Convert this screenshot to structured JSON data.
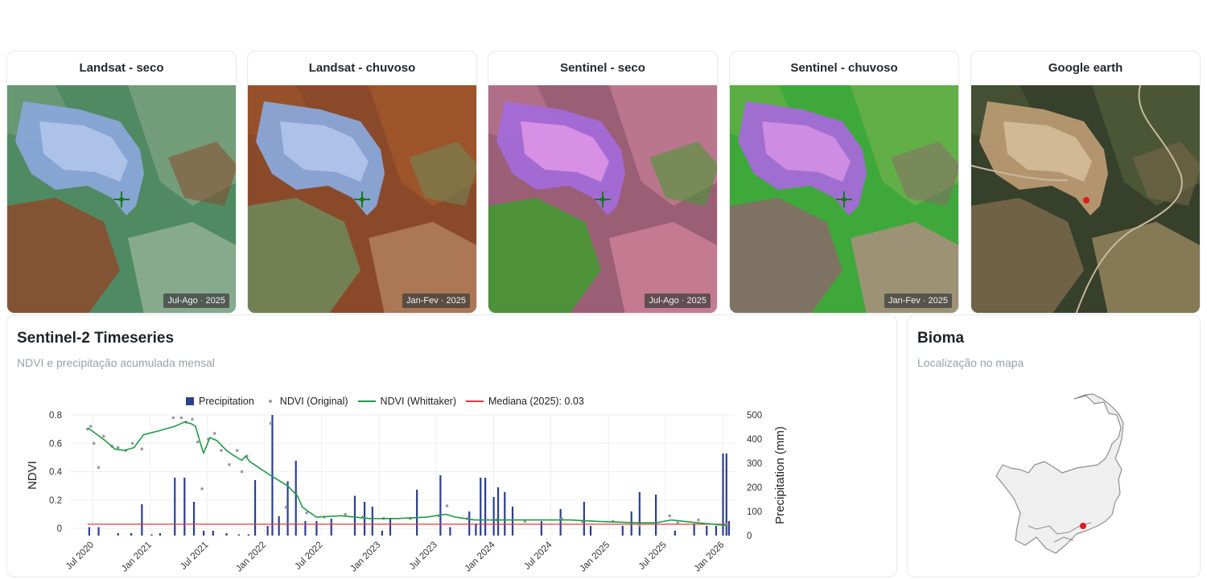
{
  "tiles": [
    {
      "title": "Landsat - seco",
      "date": "Jul-Ago · 2025",
      "palette": "landsat_dry"
    },
    {
      "title": "Landsat - chuvoso",
      "date": "Jan-Fev · 2025",
      "palette": "landsat_wet"
    },
    {
      "title": "Sentinel - seco",
      "date": "Jul-Ago · 2025",
      "palette": "sentinel_dry"
    },
    {
      "title": "Sentinel - chuvoso",
      "date": "Jan-Fev · 2025",
      "palette": "sentinel_wet"
    },
    {
      "title": "Google earth",
      "date": "",
      "palette": "google"
    }
  ],
  "palettes": {
    "landsat_dry": {
      "bg": "#4f8a63",
      "a": "#7aa07e",
      "b": "#8b4a2c",
      "c": "#9fb8a0",
      "mine": "#8aa6d8",
      "mine2": "#b7c9ee",
      "marker": "#1a7a1a"
    },
    "landsat_wet": {
      "bg": "#8a4a2a",
      "a": "#a0562c",
      "b": "#6e8a5a",
      "c": "#b98a66",
      "mine": "#8aa6d8",
      "mine2": "#b7c9ee",
      "marker": "#1a7a1a"
    },
    "sentinel_dry": {
      "bg": "#9a5e75",
      "a": "#c07a92",
      "b": "#3f9a2e",
      "c": "#d6889e",
      "mine": "#a46ad8",
      "mine2": "#e39ae8",
      "marker": "#1a7a1a"
    },
    "sentinel_wet": {
      "bg": "#3fa83a",
      "a": "#6ab04a",
      "b": "#8a6a6a",
      "c": "#c48a90",
      "mine": "#a46ad8",
      "mine2": "#d994e6",
      "marker": "#1a7a1a"
    },
    "google": {
      "bg": "#37402b",
      "a": "#4d5a38",
      "b": "#7a6a4a",
      "c": "#a8916a",
      "mine": "#b89a72",
      "mine2": "#d9c2a0",
      "marker": "#e01b1b"
    }
  },
  "timeseries": {
    "title": "Sentinel-2 Timeseries",
    "subtitle": "NDVI e precipitação acumulada mensal",
    "legend": {
      "precipitation": "Precipitation",
      "ndvi_original": "NDVI (Original)",
      "ndvi_whittaker": "NDVI (Whittaker)",
      "mediana": "Mediana (2025): 0.03"
    },
    "colors": {
      "precip": "#2b3f91",
      "ndvi_orig": "#9a9a9a",
      "whittaker": "#1f9a47",
      "mediana": "#e23b3b",
      "grid": "#eeeeee"
    }
  },
  "chart_data": {
    "type": "line",
    "xlabel": "",
    "ylabel": "NDVI",
    "y2label": "Precipitation (mm)",
    "ylim": [
      -0.05,
      0.8
    ],
    "y2lim": [
      0,
      500
    ],
    "yticks": [
      0,
      0.2,
      0.4,
      0.6,
      0.8
    ],
    "yticks_labels": [
      "0",
      "0.2",
      "0.4",
      "0.6",
      "0.8"
    ],
    "y2ticks": [
      0,
      100,
      200,
      300,
      400,
      500
    ],
    "xlim": [
      "2020-04-20",
      "2026-02-10"
    ],
    "xticks": [
      "2020-07-01",
      "2021-01-01",
      "2021-07-01",
      "2022-01-01",
      "2022-07-01",
      "2023-01-01",
      "2023-07-01",
      "2024-01-01",
      "2024-07-01",
      "2025-01-01",
      "2025-07-01",
      "2026-01-01"
    ],
    "xtick_labels": [
      "Jul 2020",
      "Jan 2021",
      "Jul 2021",
      "Jan 2022",
      "Jul 2022",
      "Jan 2023",
      "Jul 2023",
      "Jan 2024",
      "Jul 2024",
      "Jan 2025",
      "Jul 2025",
      "Jan 2026"
    ],
    "legend_position": "top",
    "grid": true,
    "series": [
      {
        "name": "NDVI (Whittaker)",
        "x": [
          "2020-06-15",
          "2020-07-10",
          "2020-08-10",
          "2020-09-10",
          "2020-10-10",
          "2020-11-10",
          "2020-12-10",
          "2021-02-01",
          "2021-03-20",
          "2021-04-20",
          "2021-05-10",
          "2021-05-25",
          "2021-06-10",
          "2021-06-20",
          "2021-07-10",
          "2021-08-01",
          "2021-09-01",
          "2021-09-20",
          "2021-10-20",
          "2021-11-01",
          "2021-11-15",
          "2022-01-15",
          "2022-03-15",
          "2022-04-15",
          "2022-05-01",
          "2022-06-15",
          "2022-09-01",
          "2022-12-01",
          "2023-03-01",
          "2023-06-01",
          "2023-08-01",
          "2023-09-01",
          "2023-11-01",
          "2024-02-01",
          "2024-06-01",
          "2024-09-01",
          "2024-12-01",
          "2025-04-01",
          "2025-06-01",
          "2025-07-20",
          "2025-09-01",
          "2025-12-01",
          "2026-01-15"
        ],
        "y": [
          0.71,
          0.67,
          0.62,
          0.56,
          0.55,
          0.57,
          0.66,
          0.69,
          0.72,
          0.75,
          0.74,
          0.72,
          0.6,
          0.53,
          0.64,
          0.62,
          0.55,
          0.52,
          0.48,
          0.51,
          0.47,
          0.38,
          0.3,
          0.23,
          0.15,
          0.08,
          0.09,
          0.07,
          0.07,
          0.08,
          0.1,
          0.08,
          0.06,
          0.06,
          0.06,
          0.06,
          0.05,
          0.04,
          0.04,
          0.06,
          0.05,
          0.03,
          0.02
        ]
      },
      {
        "name": "NDVI (Original)",
        "x": [
          "2020-06-15",
          "2020-06-25",
          "2020-07-05",
          "2020-07-20",
          "2020-08-05",
          "2020-09-01",
          "2020-09-20",
          "2020-10-15",
          "2020-11-05",
          "2020-12-05",
          "2021-03-15",
          "2021-04-10",
          "2021-04-25",
          "2021-05-15",
          "2021-06-01",
          "2021-06-15",
          "2021-07-05",
          "2021-07-25",
          "2021-08-15",
          "2021-09-10",
          "2021-10-05",
          "2021-10-20",
          "2021-11-05",
          "2022-01-20",
          "2022-03-10",
          "2022-05-15",
          "2022-07-10",
          "2022-09-15",
          "2022-11-10",
          "2023-01-15",
          "2023-04-10",
          "2023-07-10",
          "2023-08-05",
          "2023-10-10",
          "2024-01-10",
          "2024-04-10",
          "2024-08-05",
          "2024-10-10",
          "2025-01-15",
          "2025-04-10",
          "2025-07-15",
          "2025-08-10",
          "2025-10-15",
          "2026-01-10"
        ],
        "y": [
          0.7,
          0.72,
          0.6,
          0.43,
          0.65,
          0.58,
          0.57,
          0.55,
          0.6,
          0.56,
          0.78,
          0.78,
          0.75,
          0.77,
          0.61,
          0.28,
          0.63,
          0.67,
          0.55,
          0.45,
          0.55,
          0.4,
          0.51,
          0.74,
          0.15,
          0.11,
          0.08,
          0.1,
          0.08,
          0.07,
          0.07,
          0.09,
          0.16,
          0.07,
          0.06,
          0.05,
          0.07,
          0.05,
          0.05,
          0.02,
          0.09,
          0.04,
          0.06,
          0.03
        ]
      },
      {
        "name": "Mediana (2025): 0.03",
        "x": [
          "2020-06-15",
          "2026-01-20"
        ],
        "y": [
          0.03,
          0.03
        ]
      },
      {
        "name": "Precipitation",
        "axis": "y2",
        "x": [
          "2020-06-20",
          "2020-07-20",
          "2020-09-20",
          "2020-11-01",
          "2020-12-05",
          "2021-01-05",
          "2021-02-01",
          "2021-03-20",
          "2021-04-20",
          "2021-05-20",
          "2021-06-20",
          "2021-07-20",
          "2021-09-01",
          "2021-10-10",
          "2021-11-10",
          "2021-12-01",
          "2022-01-10",
          "2022-01-25",
          "2022-02-15",
          "2022-03-15",
          "2022-04-10",
          "2022-05-10",
          "2022-06-15",
          "2022-08-01",
          "2022-10-15",
          "2022-11-15",
          "2022-12-10",
          "2023-01-10",
          "2023-02-05",
          "2023-05-01",
          "2023-07-15",
          "2023-08-15",
          "2023-10-15",
          "2023-11-05",
          "2023-11-20",
          "2023-12-05",
          "2024-01-01",
          "2024-01-15",
          "2024-02-05",
          "2024-03-01",
          "2024-06-01",
          "2024-08-01",
          "2024-10-15",
          "2024-11-05",
          "2025-02-15",
          "2025-03-15",
          "2025-04-10",
          "2025-06-01",
          "2025-08-01",
          "2025-10-01",
          "2025-11-10",
          "2025-12-10",
          "2026-01-01",
          "2026-01-12",
          "2026-01-20"
        ],
        "y": [
          35,
          35,
          10,
          10,
          130,
          5,
          10,
          240,
          240,
          140,
          20,
          20,
          10,
          5,
          5,
          230,
          40,
          500,
          80,
          225,
          310,
          60,
          60,
          70,
          165,
          140,
          120,
          20,
          70,
          190,
          250,
          35,
          100,
          50,
          240,
          240,
          160,
          200,
          180,
          120,
          60,
          110,
          140,
          40,
          40,
          100,
          180,
          170,
          20,
          50,
          40,
          40,
          340,
          340,
          60
        ]
      }
    ]
  },
  "bioma": {
    "title": "Bioma",
    "subtitle": "Localização no mapa",
    "marker_color": "#e01b1b"
  }
}
